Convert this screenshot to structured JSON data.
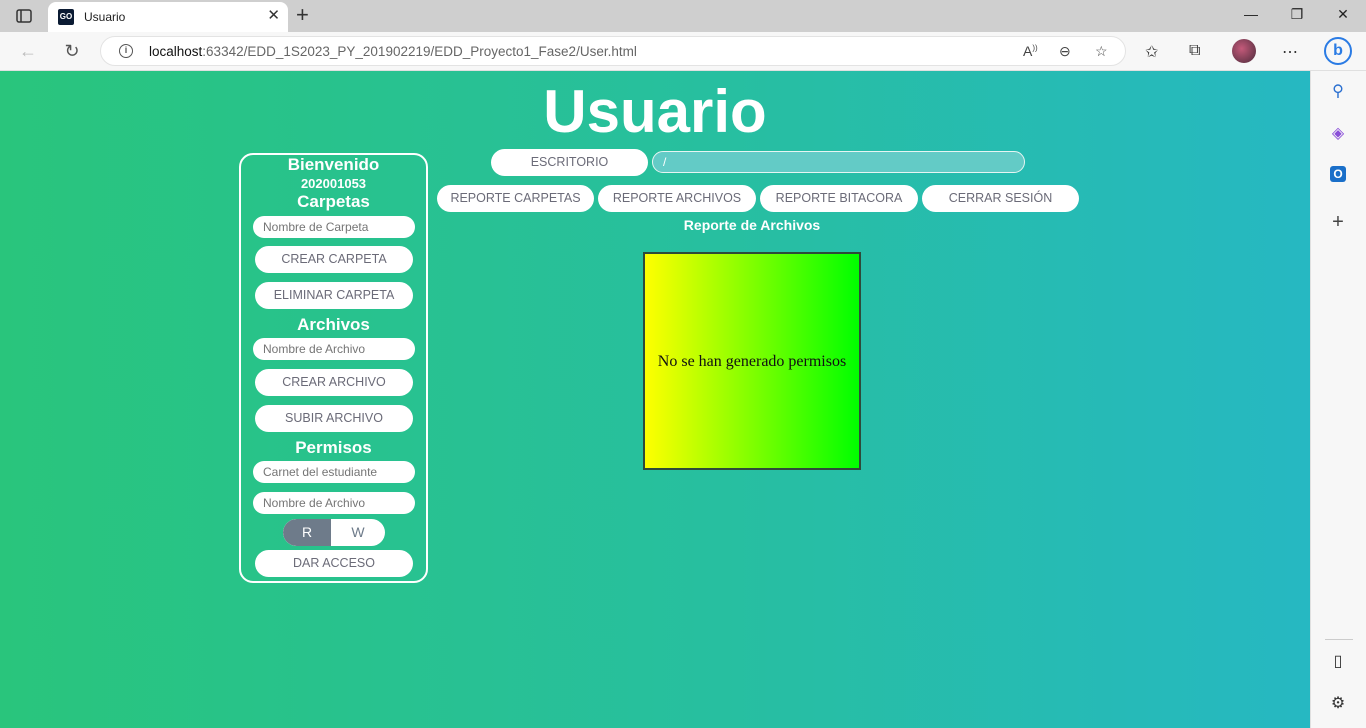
{
  "browser": {
    "tab_title": "Usuario",
    "favicon_text": "GO",
    "url_host": "localhost",
    "url_rest": ":63342/EDD_1S2023_PY_201902219/EDD_Proyecto1_Fase2/User.html"
  },
  "page": {
    "title": "Usuario",
    "panel": {
      "welcome": "Bienvenido",
      "user_id": "202001053",
      "folders_heading": "Carpetas",
      "folder_name_placeholder": "Nombre de Carpeta",
      "create_folder": "CREAR CARPETA",
      "delete_folder": "ELIMINAR CARPETA",
      "files_heading": "Archivos",
      "file_name_placeholder": "Nombre de Archivo",
      "create_file": "CREAR ARCHIVO",
      "upload_file": "SUBIR ARCHIVO",
      "permissions_heading": "Permisos",
      "student_id_placeholder": "Carnet del estudiante",
      "perm_file_placeholder": "Nombre de Archivo",
      "toggle_r": "R",
      "toggle_w": "W",
      "grant_access": "DAR ACCESO"
    },
    "desktop_button": "ESCRITORIO",
    "path_value": "/",
    "reports": {
      "folders": "REPORTE CARPETAS",
      "files": "REPORTE ARCHIVOS",
      "log": "REPORTE BITACORA",
      "logout": "CERRAR SESIÓN"
    },
    "report_title": "Reporte de Archivos",
    "report_message": "No se han generado permisos"
  },
  "colors": {
    "background_start": "#29c57c",
    "background_end": "#26b8c2",
    "toggle_active": "#6e7b8a"
  }
}
